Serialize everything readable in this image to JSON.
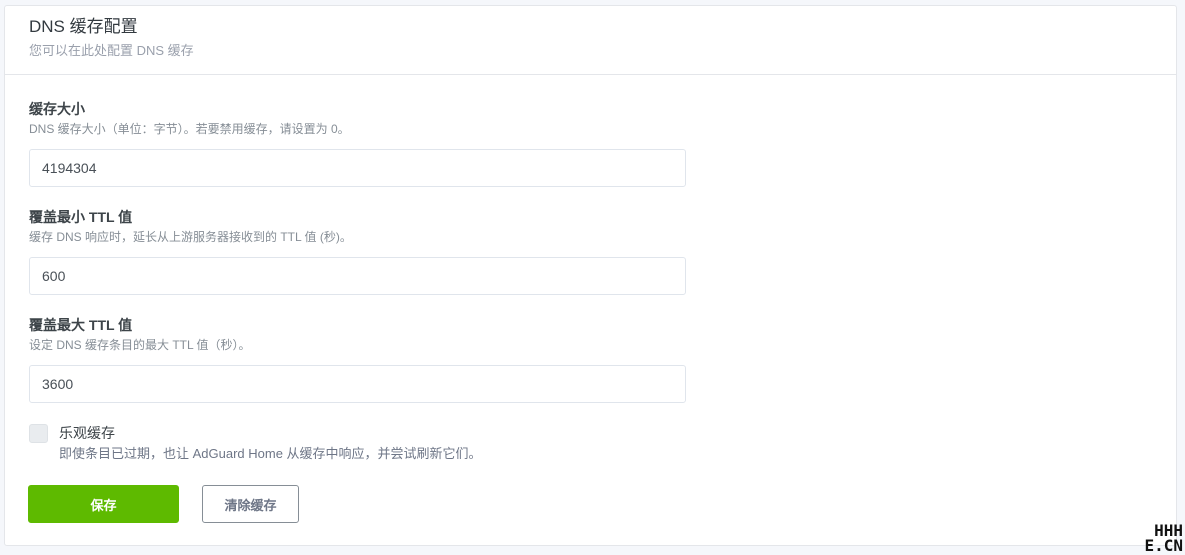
{
  "header": {
    "title": "DNS 缓存配置",
    "subtitle": "您可以在此处配置 DNS 缓存"
  },
  "fields": [
    {
      "label": "缓存大小",
      "description": "DNS 缓存大小（单位：字节）。若要禁用缓存，请设置为 0。",
      "value": "4194304"
    },
    {
      "label": "覆盖最小 TTL 值",
      "description": "缓存 DNS 响应时，延长从上游服务器接收到的 TTL 值 (秒)。",
      "value": "600"
    },
    {
      "label": "覆盖最大 TTL 值",
      "description": "设定 DNS 缓存条目的最大 TTL 值（秒）。",
      "value": "3600"
    }
  ],
  "optimistic": {
    "label": "乐观缓存",
    "description": "即使条目已过期，也让 AdGuard Home 从缓存中响应，并尝试刷新它们。",
    "checked": false
  },
  "actions": {
    "save_label": "保存",
    "clear_label": "清除缓存"
  },
  "watermark": {
    "line1": "HHH",
    "line2": "E.CN"
  },
  "colors": {
    "primary": "#5eba00",
    "border": "#e4e6ea"
  }
}
